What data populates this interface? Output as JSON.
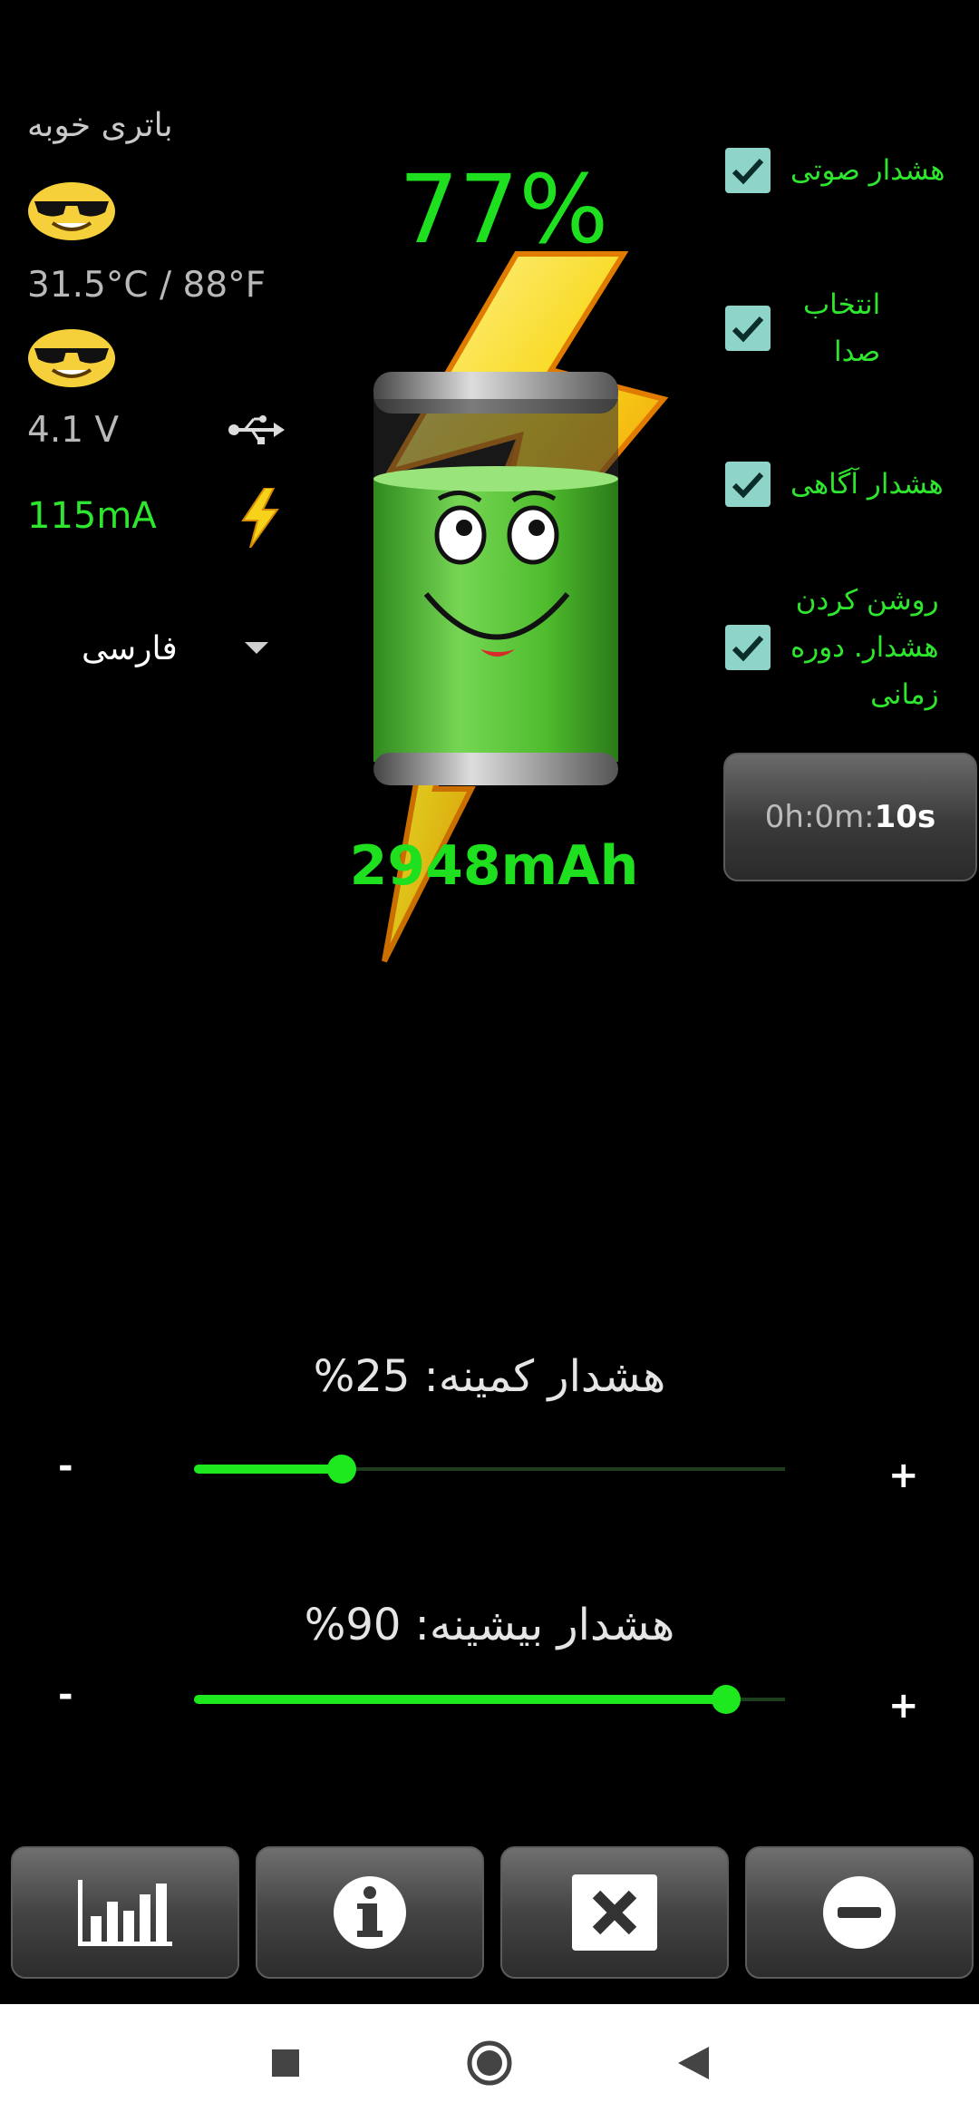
{
  "status": {
    "text": "باتری خوبه",
    "emoji_1": "sunglasses-smiley-icon",
    "temperature": "31.5°C / 88°F",
    "emoji_2": "sunglasses-smiley-icon",
    "voltage": "4.1 V",
    "current": "115mA"
  },
  "language": {
    "selected": "فارسی"
  },
  "battery": {
    "percent_label": "77%",
    "level_percent": 77,
    "capacity": "2948mAh"
  },
  "settings": {
    "sound_alert": {
      "label": "هشدار صوتی",
      "checked": true
    },
    "select_sound": {
      "label_line1": "انتخاب",
      "label_line2": "صدا",
      "checked": true
    },
    "notification_alert": {
      "label": "هشدار آگاهی",
      "checked": true
    },
    "periodic_alert": {
      "label_line1": "روشن کردن",
      "label_line2": "هشدار. دوره",
      "label_line3": "زمانی",
      "checked": true
    },
    "timer": {
      "prefix": "0h:0m:",
      "seconds": "10s"
    }
  },
  "sliders": {
    "min_alert": {
      "title": "هشدار کمینه: 25%",
      "value_percent": 25,
      "minus": "-",
      "plus": "+"
    },
    "max_alert": {
      "title": "هشدار بیشینه: 90%",
      "value_percent": 90,
      "minus": "-",
      "plus": "+"
    }
  },
  "colors": {
    "accent_green": "#1ee81e",
    "checkbox": "#8fd4c9",
    "background": "#000000"
  },
  "toolbar": [
    "chart-icon",
    "info-icon",
    "close-icon",
    "minus-circle-icon"
  ],
  "navbar": [
    "recents-square-icon",
    "home-circle-icon",
    "back-triangle-icon"
  ]
}
